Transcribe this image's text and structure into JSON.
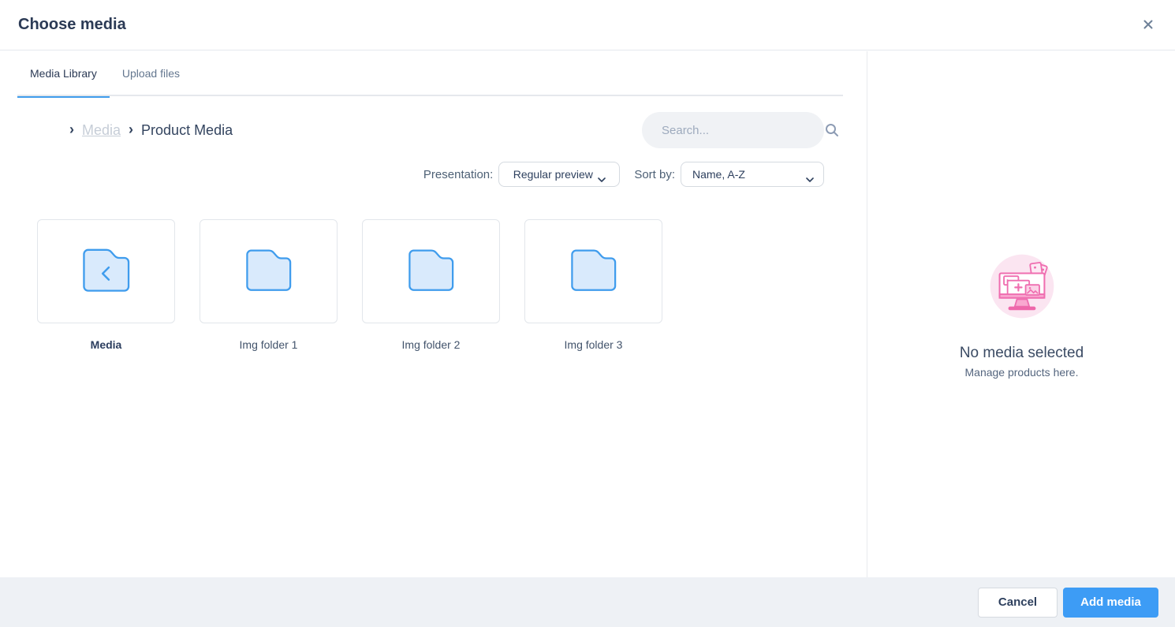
{
  "modal": {
    "title": "Choose media"
  },
  "tabs": {
    "media_library": "Media Library",
    "upload_files": "Upload files"
  },
  "breadcrumb": {
    "parent": "Media",
    "current": "Product Media"
  },
  "search": {
    "placeholder": "Search..."
  },
  "controls": {
    "presentation_label": "Presentation:",
    "presentation_value": "Regular preview",
    "sort_label": "Sort by:",
    "sort_value": "Name, A-Z"
  },
  "folders": [
    {
      "name": "Media",
      "type": "parent-back"
    },
    {
      "name": "Img folder 1",
      "type": "folder"
    },
    {
      "name": "Img folder 2",
      "type": "folder"
    },
    {
      "name": "Img folder 3",
      "type": "folder"
    }
  ],
  "sidebar": {
    "empty_title": "No media selected",
    "empty_subtitle": "Manage products here."
  },
  "footer": {
    "cancel_label": "Cancel",
    "submit_label": "Add media"
  },
  "icons": {
    "close": "close-icon",
    "search": "magnifier-icon",
    "dropdown": "chevron-down-icon",
    "breadcrumb_separator": "chevron-right-icon",
    "back_folder": "folder-back-icon",
    "folder": "folder-icon",
    "empty": "monitor-media-illustration"
  },
  "colors": {
    "accent_blue": "#3d9cf5",
    "tab_underline": "#3f9ceb",
    "folder_stroke": "#3f9ced",
    "folder_fill": "#d9eafc",
    "pink_stroke": "#ef6eb0",
    "pink_bg": "#fbe5f1",
    "footer_bg": "#eef1f5"
  }
}
